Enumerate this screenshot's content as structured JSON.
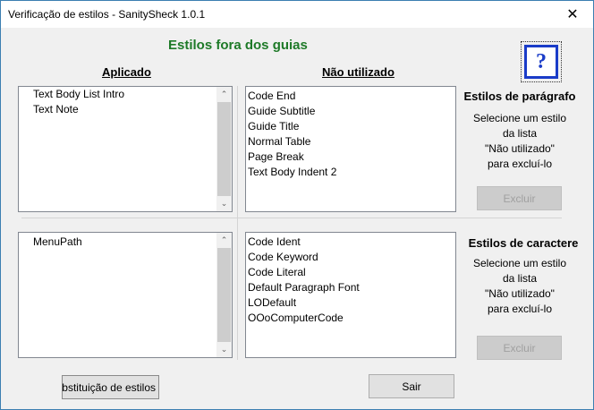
{
  "window": {
    "title": "Verificação de estilos - SanitySheck 1.0.1",
    "close_glyph": "✕"
  },
  "header": {
    "heading": "Estilos fora dos guias",
    "col_applied": "Aplicado",
    "col_unused": "Não utilizado",
    "help_glyph": "?"
  },
  "paragraph": {
    "applied_items": [
      "Text Body List Intro",
      "Text Note"
    ],
    "unused_items": [
      "Code End",
      "Guide Subtitle",
      "Guide Title",
      "Normal Table",
      "Page Break",
      "Text Body Indent 2"
    ],
    "title": "Estilos de parágrafo",
    "desc": [
      "Selecione um estilo",
      "da lista",
      "\"Não utilizado\"",
      "para excluí-lo"
    ],
    "delete_label": "Excluir"
  },
  "character": {
    "applied_items": [
      "MenuPath"
    ],
    "unused_items": [
      "Code Ident",
      "Code Keyword",
      "Code Literal",
      "Default Paragraph Font",
      "LODefault",
      "OOoComputerCode"
    ],
    "title": "Estilos de caractere",
    "desc": [
      "Selecione um estilo",
      "da lista",
      "\"Não utilizado\"",
      "para excluí-lo"
    ],
    "delete_label": "Excluir"
  },
  "footer": {
    "substitution_label": "Substituição de estilos",
    "exit_label": "Sair"
  },
  "scroll": {
    "up_glyph": "⌃",
    "down_glyph": "⌄"
  }
}
